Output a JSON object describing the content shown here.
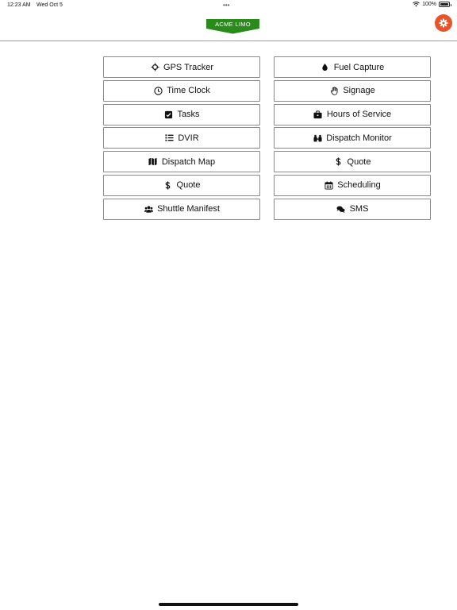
{
  "status_bar": {
    "time": "12:23 AM",
    "date": "Wed Oct 5",
    "battery": "100%"
  },
  "header": {
    "brand": "ACME LIMO",
    "brand_color": "#2a8a1b",
    "settings_color": "#e8532b"
  },
  "menu": {
    "left": [
      {
        "label": "GPS Tracker",
        "icon": "crosshairs-icon"
      },
      {
        "label": "Time Clock",
        "icon": "clock-icon"
      },
      {
        "label": "Tasks",
        "icon": "check-square-icon"
      },
      {
        "label": "DVIR",
        "icon": "list-icon"
      },
      {
        "label": "Dispatch Map",
        "icon": "map-icon"
      },
      {
        "label": "Quote",
        "icon": "dollar-icon"
      },
      {
        "label": "Shuttle Manifest",
        "icon": "users-icon"
      }
    ],
    "right": [
      {
        "label": "Fuel Capture",
        "icon": "droplet-icon"
      },
      {
        "label": "Signage",
        "icon": "hand-icon"
      },
      {
        "label": "Hours of Service",
        "icon": "briefcase-icon"
      },
      {
        "label": "Dispatch Monitor",
        "icon": "binoculars-icon"
      },
      {
        "label": "Quote",
        "icon": "dollar-icon"
      },
      {
        "label": "Scheduling",
        "icon": "calendar-icon"
      },
      {
        "label": "SMS",
        "icon": "comments-icon"
      }
    ]
  }
}
